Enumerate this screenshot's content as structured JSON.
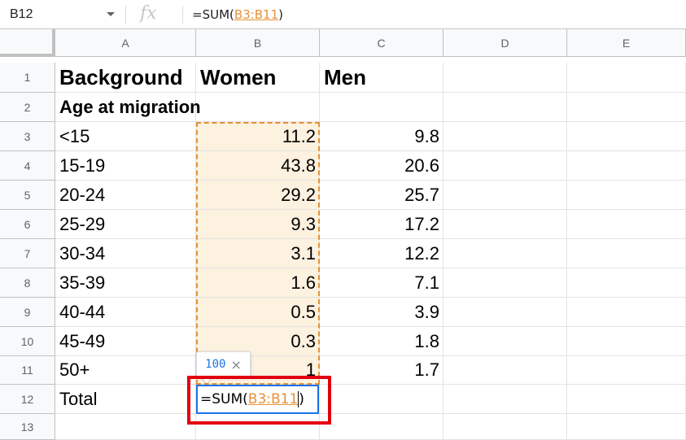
{
  "name_box": {
    "value": "B12"
  },
  "formula_bar": {
    "fx_label": "fx",
    "prefix": "=SUM(",
    "range": "B3:B11",
    "suffix": ")"
  },
  "columns": [
    "A",
    "B",
    "C",
    "D",
    "E"
  ],
  "active_column": "B",
  "rows": [
    {
      "num": "1",
      "a": "Background",
      "b": "Women",
      "c": "Men"
    },
    {
      "num": "2",
      "a": "Age at migration",
      "b": "",
      "c": ""
    },
    {
      "num": "3",
      "a": "<15",
      "b": "11.2",
      "c": "9.8"
    },
    {
      "num": "4",
      "a": "15-19",
      "b": "43.8",
      "c": "20.6"
    },
    {
      "num": "5",
      "a": "20-24",
      "b": "29.2",
      "c": "25.7"
    },
    {
      "num": "6",
      "a": "25-29",
      "b": "9.3",
      "c": "17.2"
    },
    {
      "num": "7",
      "a": "30-34",
      "b": "3.1",
      "c": "12.2"
    },
    {
      "num": "8",
      "a": "35-39",
      "b": "1.6",
      "c": "7.1"
    },
    {
      "num": "9",
      "a": "40-44",
      "b": "0.5",
      "c": "3.9"
    },
    {
      "num": "10",
      "a": "45-49",
      "b": "0.3",
      "c": "1.8"
    },
    {
      "num": "11",
      "a": "50+",
      "b": "1",
      "c": "1.7"
    },
    {
      "num": "12",
      "a": "Total",
      "b": "",
      "c": ""
    },
    {
      "num": "13",
      "a": "",
      "b": "",
      "c": ""
    }
  ],
  "active_row": "12",
  "edit_cell": {
    "prefix": "=SUM(",
    "range": "B3:B11",
    "suffix": ")"
  },
  "sum_preview": {
    "value": "100",
    "close": "×"
  },
  "colors": {
    "range_highlight": "#fdf1df",
    "range_border": "#e69138",
    "edit_border": "#1a73e8",
    "annotation_red": "#e3000f"
  }
}
